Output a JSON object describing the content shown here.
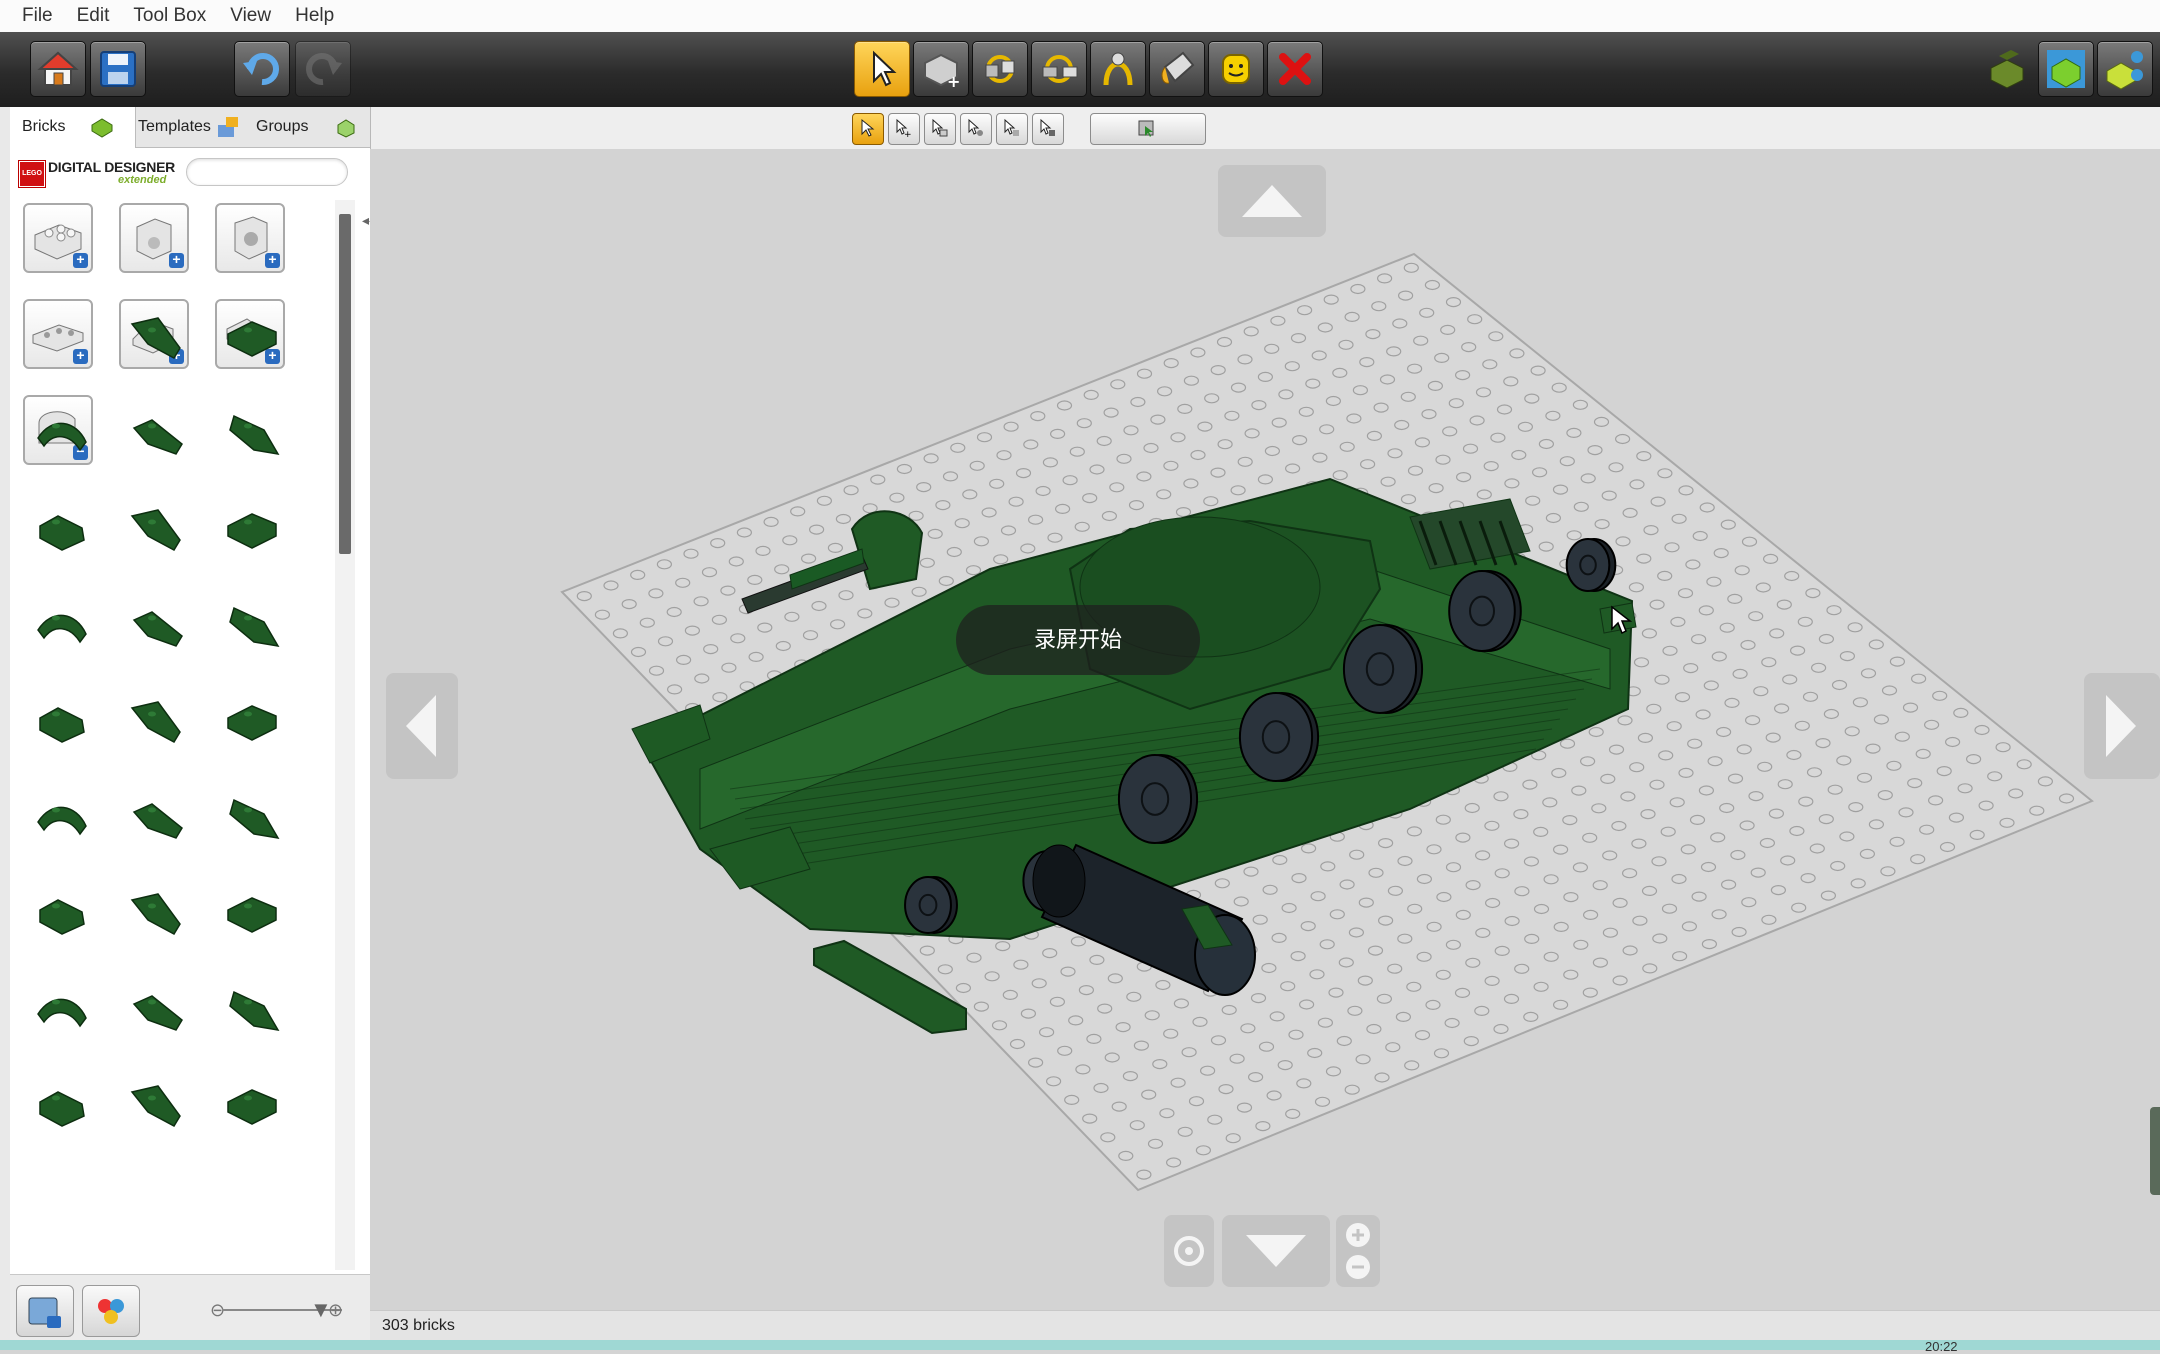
{
  "menu": [
    "File",
    "Edit",
    "Tool Box",
    "View",
    "Help"
  ],
  "toolbar": {
    "left": [
      {
        "name": "home-button",
        "icon": "home-icon"
      },
      {
        "name": "save-button",
        "icon": "save-icon"
      },
      {
        "name": "undo-button",
        "icon": "undo-icon"
      },
      {
        "name": "redo-button",
        "icon": "redo-icon",
        "disabled": true
      }
    ],
    "tools": [
      {
        "name": "select-tool-button",
        "icon": "cursor-icon",
        "active": true
      },
      {
        "name": "clone-tool-button",
        "icon": "clone-brick-icon"
      },
      {
        "name": "hinge-tool-button",
        "icon": "hinge-icon"
      },
      {
        "name": "hinge-align-tool-button",
        "icon": "hinge-align-icon"
      },
      {
        "name": "flex-tool-button",
        "icon": "flex-icon"
      },
      {
        "name": "paint-tool-button",
        "icon": "paint-bucket-icon"
      },
      {
        "name": "decoration-tool-button",
        "icon": "minifig-head-icon"
      },
      {
        "name": "delete-tool-button",
        "icon": "delete-x-icon"
      }
    ],
    "modes": [
      {
        "name": "build-mode-button",
        "icon": "build-mode-icon"
      },
      {
        "name": "view-mode-button",
        "icon": "view-mode-icon"
      },
      {
        "name": "instructions-mode-button",
        "icon": "instructions-mode-icon"
      }
    ]
  },
  "subtools": [
    "select-single",
    "select-multiple",
    "select-connected",
    "select-same-color",
    "select-same-shape",
    "select-same-color-shape",
    "invert-selection"
  ],
  "panel": {
    "tabs": [
      "Bricks",
      "Templates",
      "Groups"
    ],
    "brand": {
      "name": "DIGITAL DESIGNER",
      "sub": "extended"
    },
    "search_placeholder": "",
    "categories_count": 7
  },
  "status": {
    "bricks": "303 bricks"
  },
  "overlay": {
    "toast": "录屏开始"
  },
  "taskbar": {
    "clock": "20:22"
  },
  "colors": {
    "brick_green": "#1f5a25",
    "accent": "#f0b020"
  }
}
